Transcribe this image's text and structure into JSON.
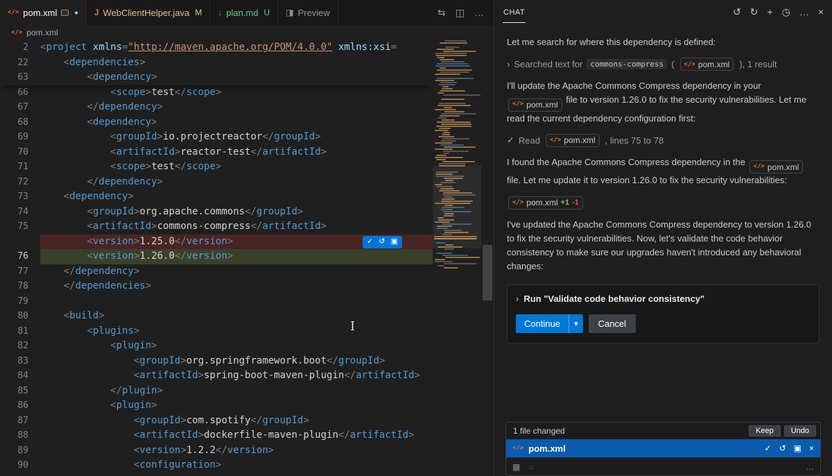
{
  "editor": {
    "tabs": [
      {
        "label": "pom.xml"
      },
      {
        "label": "WebClientHelper.java",
        "git": "M"
      },
      {
        "label": "plan.md",
        "git": "U"
      },
      {
        "label": "Preview"
      }
    ],
    "breadcrumb": "pom.xml",
    "sticky": [
      {
        "n": "2",
        "t": "<project xmlns=\"http://maven.apache.org/POM/4.0.0\" xmlns:xsi="
      },
      {
        "n": "22",
        "t": "    <dependencies>"
      },
      {
        "n": "63",
        "t": "        <dependency>"
      }
    ],
    "lines": [
      {
        "n": "66",
        "t": "            <scope>test</scope>"
      },
      {
        "n": "67",
        "t": "        </dependency>"
      },
      {
        "n": "68",
        "t": "        <dependency>"
      },
      {
        "n": "69",
        "t": "            <groupId>io.projectreactor</groupId>"
      },
      {
        "n": "70",
        "t": "            <artifactId>reactor-test</artifactId>"
      },
      {
        "n": "71",
        "t": "            <scope>test</scope>"
      },
      {
        "n": "72",
        "t": "        </dependency>"
      },
      {
        "n": "73",
        "t": "    <dependency>"
      },
      {
        "n": "74",
        "t": "        <groupId>org.apache.commons</groupId>"
      },
      {
        "n": "75",
        "t": "        <artifactId>commons-compress</artifactId>"
      },
      {
        "n": "",
        "t": "        <version>1.25.0</version>",
        "k": "rm"
      },
      {
        "n": "76",
        "t": "        <version>1.26.0</version>",
        "k": "add"
      },
      {
        "n": "77",
        "t": "    </dependency>"
      },
      {
        "n": "78",
        "t": "    </dependencies>"
      },
      {
        "n": "79",
        "t": ""
      },
      {
        "n": "80",
        "t": "    <build>"
      },
      {
        "n": "81",
        "t": "        <plugins>"
      },
      {
        "n": "82",
        "t": "            <plugin>"
      },
      {
        "n": "83",
        "t": "                <groupId>org.springframework.boot</groupId>"
      },
      {
        "n": "84",
        "t": "                <artifactId>spring-boot-maven-plugin</artifactId>"
      },
      {
        "n": "85",
        "t": "            </plugin>"
      },
      {
        "n": "86",
        "t": "            <plugin>"
      },
      {
        "n": "87",
        "t": "                <groupId>com.spotify</groupId>"
      },
      {
        "n": "88",
        "t": "                <artifactId>dockerfile-maven-plugin</artifactId>"
      },
      {
        "n": "89",
        "t": "                <version>1.2.2</version>"
      },
      {
        "n": "90",
        "t": "                <configuration>"
      }
    ]
  },
  "chat": {
    "title": "CHAT",
    "file_pom": "pom.xml",
    "m1": "Let me search for where this dependency is defined:",
    "search": {
      "prefix": "Searched text for",
      "query": "commons-compress",
      "paren": "(",
      "suffix": "), 1 result"
    },
    "m2a": "I'll update the Apache Commons Compress dependency in your",
    "m2b": "file to version 1.26.0 to fix the security vulnerabilities. Let me read the current dependency configuration first:",
    "read": {
      "label": "Read",
      "suffix": ", lines 75 to 78"
    },
    "m3a": "I found the Apache Commons Compress dependency in the",
    "m3b": "file. Let me update it to version 1.26.0 to fix the security vulnerabilities:",
    "edit": {
      "added": "+1",
      "removed": "-1"
    },
    "m4": "I've updated the Apache Commons Compress dependency to version 1.26.0 to fix the security vulnerabilities. Now, let's validate the code behavior consistency to make sure our upgrades haven't introduced any behavioral changes:",
    "confirm": {
      "title": "Run \"Validate code behavior consistency\"",
      "continue_label": "Continue",
      "cancel_label": "Cancel"
    },
    "files": {
      "label": "1 file changed",
      "keep": "Keep",
      "undo": "Undo",
      "file": "pom.xml"
    }
  }
}
